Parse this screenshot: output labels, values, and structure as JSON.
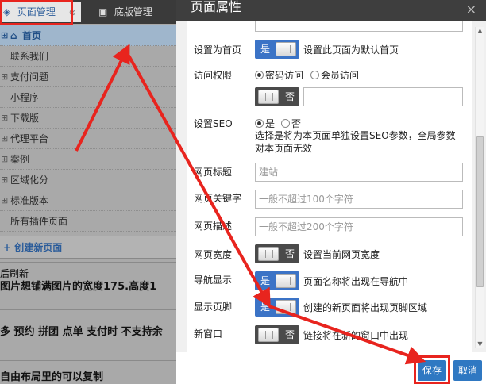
{
  "left_panel": {
    "tabs": [
      {
        "label": "页面管理",
        "icon": "layers-icon",
        "close": "⊗"
      },
      {
        "label": "底版管理",
        "icon": "document-icon"
      }
    ],
    "tree": [
      {
        "label": "首页",
        "home": true
      },
      {
        "label": "联系我们"
      },
      {
        "label": "支付问题"
      },
      {
        "label": "小程序"
      },
      {
        "label": "下载版"
      },
      {
        "label": "代理平台"
      },
      {
        "label": "案例"
      },
      {
        "label": "区域化分"
      },
      {
        "label": "标准版本"
      },
      {
        "label": "所有插件页面"
      }
    ],
    "create_label": "+ 创建新页面",
    "background_text": [
      "后刷新",
      "图片想铺满图片的宽度175.高度1",
      "多 预约 拼团 点单 支付时 不支持余",
      "自由布局里的可以复制"
    ]
  },
  "modal": {
    "title": "页面属性",
    "close": "×",
    "rows": {
      "home": {
        "label": "设置为首页",
        "toggle": "是",
        "desc": "设置此页面为默认首页"
      },
      "access": {
        "label": "访问权限",
        "options": [
          "密码访问",
          "会员访问"
        ],
        "toggle": "否",
        "password_value": ""
      },
      "seo": {
        "label": "设置SEO",
        "options": [
          "是",
          "否"
        ],
        "desc": "选择是将为本页面单独设置SEO参数，全局参数对本页面无效"
      },
      "page_title": {
        "label": "网页标题",
        "value": "建站"
      },
      "keywords": {
        "label": "网页关键字",
        "placeholder": "一般不超过100个字符"
      },
      "description": {
        "label": "网页描述",
        "placeholder": "一般不超过200个字符"
      },
      "width": {
        "label": "网页宽度",
        "toggle": "否",
        "desc": "设置当前网页宽度"
      },
      "nav": {
        "label": "导航显示",
        "toggle": "是",
        "desc": "页面名称将出现在导航中"
      },
      "footer": {
        "label": "显示页脚",
        "toggle": "是",
        "desc": "创建的新页面将出现页脚区域"
      },
      "new_window": {
        "label": "新窗口",
        "toggle": "否",
        "desc": "链接将在新的窗口中出现"
      }
    },
    "buttons": {
      "save": "保存",
      "cancel": "取消"
    }
  },
  "colors": {
    "annotation": "#e8241e",
    "toggle_on": "#3b73c6",
    "toggle_off": "#4a4a4a",
    "button": "#2f78c2"
  }
}
